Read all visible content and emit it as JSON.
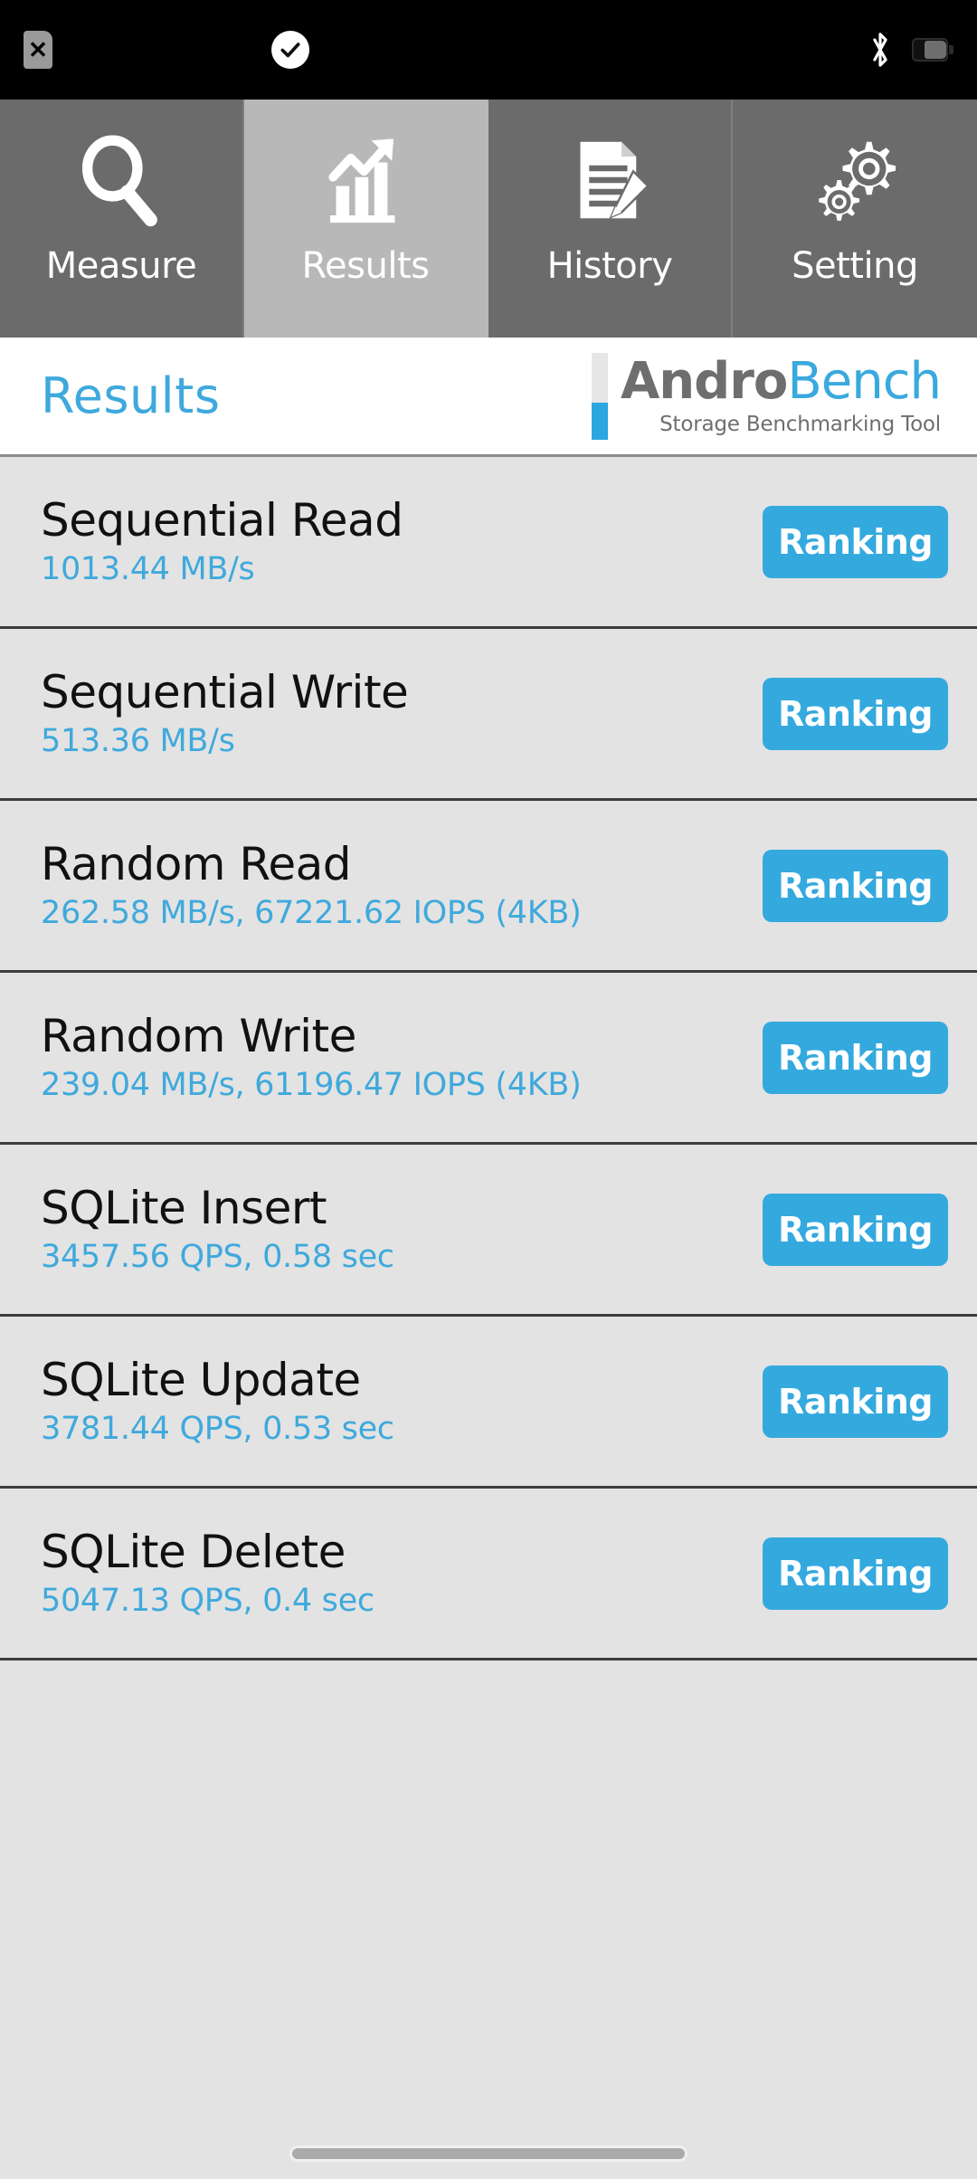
{
  "status_bar": {
    "icons": [
      {
        "name": "sim-card-off-icon",
        "glyph": "✕"
      },
      {
        "name": "check-circle-icon",
        "glyph": "✓"
      },
      {
        "name": "bluetooth-icon",
        "glyph": "bluetooth"
      },
      {
        "name": "battery-icon",
        "glyph": "battery"
      }
    ]
  },
  "tabs": [
    {
      "label": "Measure",
      "icon": "magnifier-icon",
      "active": false
    },
    {
      "label": "Results",
      "icon": "bar-chart-arrow-icon",
      "active": true
    },
    {
      "label": "History",
      "icon": "document-pencil-icon",
      "active": false
    },
    {
      "label": "Setting",
      "icon": "gears-icon",
      "active": false
    }
  ],
  "header": {
    "title": "Results",
    "brand_andro": "Andro",
    "brand_bench": "Bench",
    "tagline": "Storage Benchmarking Tool"
  },
  "results": {
    "ranking_label": "Ranking",
    "rows": [
      {
        "name": "Sequential Read",
        "value": "1013.44 MB/s"
      },
      {
        "name": "Sequential Write",
        "value": "513.36 MB/s"
      },
      {
        "name": "Random Read",
        "value": "262.58 MB/s, 67221.62 IOPS (4KB)"
      },
      {
        "name": "Random Write",
        "value": "239.04 MB/s, 61196.47 IOPS (4KB)"
      },
      {
        "name": "SQLite Insert",
        "value": "3457.56 QPS, 0.58 sec"
      },
      {
        "name": "SQLite Update",
        "value": "3781.44 QPS, 0.53 sec"
      },
      {
        "name": "SQLite Delete",
        "value": "5047.13 QPS, 0.4 sec"
      }
    ]
  },
  "colors": {
    "accent_blue": "#34a9de",
    "value_blue": "#3fa9dc",
    "tab_inactive": "#6b6b6b",
    "tab_active": "#b8b8b8",
    "list_bg": "#e3e3e3",
    "brand_gray": "#6e6e6e"
  }
}
